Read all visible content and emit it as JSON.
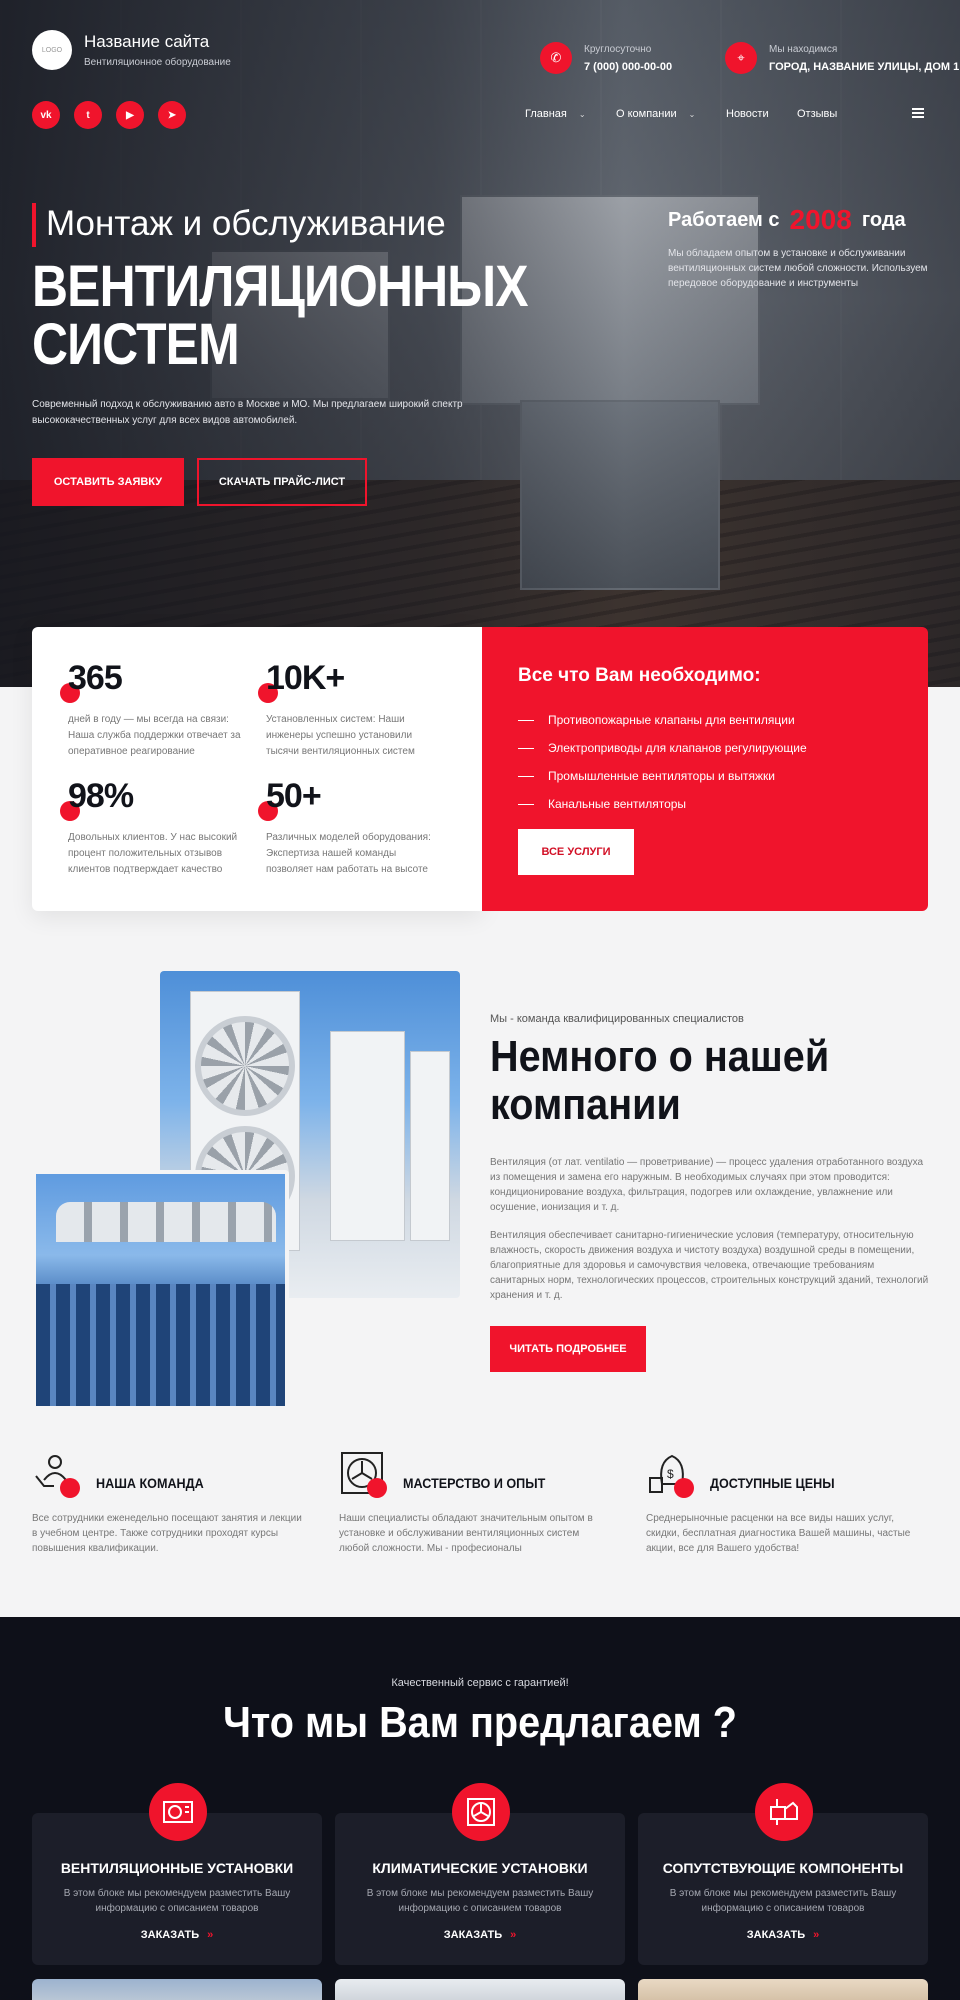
{
  "header": {
    "logo_text": "LOGO",
    "site_title": "Название сайта",
    "site_subtitle": "Вентиляционное оборудование",
    "contacts": [
      {
        "icon": "phone-icon",
        "label": "Круглосуточно",
        "value": "7 (000) 000-00-00"
      },
      {
        "icon": "location-icon",
        "label": "Мы находимся",
        "value": "ГОРОД, НАЗВАНИЕ УЛИЦЫ, ДОМ 1"
      }
    ],
    "social": [
      {
        "icon": "vk-icon",
        "glyph": "vk"
      },
      {
        "icon": "twitter-icon",
        "glyph": "t"
      },
      {
        "icon": "youtube-icon",
        "glyph": "▶"
      },
      {
        "icon": "telegram-icon",
        "glyph": "➤"
      }
    ],
    "nav": [
      {
        "label": "Главная",
        "has_dropdown": true
      },
      {
        "label": "О компании",
        "has_dropdown": true
      },
      {
        "label": "Новости",
        "has_dropdown": false
      },
      {
        "label": "Отзывы",
        "has_dropdown": false
      }
    ]
  },
  "hero": {
    "title_small": "Монтаж и обслуживание",
    "title_big_1": "ВЕНТИЛЯЦИОННЫХ",
    "title_big_2": "СИСТЕМ",
    "description": "Современный подход к обслуживанию авто в Москве и МО. Мы предлагаем широкий спектр высококачественных услуг для всех видов автомобилей.",
    "btn_primary": "ОСТАВИТЬ ЗАЯВКУ",
    "btn_secondary": "СКАЧАТЬ ПРАЙС-ЛИСТ",
    "work_prefix": "Работаем с",
    "work_year": "2008",
    "work_suffix": "года",
    "work_desc": "Мы обладаем опытом в установке и обслуживании вентиляционных систем любой сложности. Используем передовое оборудование и инструменты"
  },
  "stats": [
    {
      "value": "365",
      "text": "дней в году — мы всегда на связи: Наша служба поддержки отвечает за оперативное реагирование"
    },
    {
      "value": "10K+",
      "text": "Установленных систем: Наши инженеры успешно установили тысячи вентиляционных систем"
    },
    {
      "value": "98%",
      "text": "Довольных клиентов. У нас высокий процент положительных отзывов клиентов подтверждает качество"
    },
    {
      "value": "50+",
      "text": "Различных моделей оборудования: Экспертиза нашей команды позволяет нам работать на высоте"
    }
  ],
  "needs": {
    "title": "Все что Вам необходимо:",
    "items": [
      "Противопожарные клапаны для вентиляции",
      "Электроприводы для клапанов регулирующие",
      "Промышленные вентиляторы и вытяжки",
      "Канальные вентиляторы"
    ],
    "button": "ВСЕ УСЛУГИ"
  },
  "about": {
    "pretitle": "Мы - команда квалифицированных специалистов",
    "title": "Немного о нашей компании",
    "paragraph_1": "Вентиляция (от лат. ventilatio — проветривание) — процесс удаления отработанного воздуха из помещения и замена его наружным. В необходимых случаях при этом проводится: кондиционирование воздуха, фильтрация, подогрев или охлаждение, увлажнение или осушение, ионизация и т. д.",
    "paragraph_2": "Вентиляция обеспечивает санитарно-гигиенические условия (температуру, относительную влажность, скорость движения воздуха и чистоту воздуха) воздушной среды в помещении, благоприятные для здоровья и самочувствия человека, отвечающие требованиям санитарных норм, технологических процессов, строительных конструкций зданий, технологий хранения и т. д.",
    "button": "ЧИТАТЬ ПОДРОБНЕЕ"
  },
  "features": [
    {
      "icon": "team-icon",
      "title": "НАША КОМАНДА",
      "text": "Все сотрудники еженедельно посещают занятия и лекции в учебном центре. Также сотрудники проходят курсы повышения квалификации."
    },
    {
      "icon": "fan-icon",
      "title": "МАСТЕРСТВО И ОПЫТ",
      "text": "Наши специалисты обладают значительным опытом в установке и обслуживании вентиляционных систем любой сложности. Мы - професионалы"
    },
    {
      "icon": "money-icon",
      "title": "ДОСТУПНЫЕ ЦЕНЫ",
      "text": "Среднерыночные расценки на все виды наших услуг, скидки, бесплатная диагностика Вашей машины, частые акции, все для Вашего удобства!"
    }
  ],
  "offers": {
    "pretitle": "Качественный сервис с гарантией!",
    "title": "Что мы Вам предлагаем ?",
    "cards": [
      {
        "icon": "ac-unit-icon",
        "title": "ВЕНТИЛЯЦИОННЫЕ УСТАНОВКИ",
        "text": "В этом блоке мы рекомендуем разместить Вашу информацию с описанием товаров",
        "order": "ЗАКАЗАТЬ"
      },
      {
        "icon": "fan-unit-icon",
        "title": "КЛИМАТИЧЕСКИЕ УСТАНОВКИ",
        "text": "В этом блоке мы рекомендуем разместить Вашу информацию с описанием товаров",
        "order": "ЗАКАЗАТЬ"
      },
      {
        "icon": "components-icon",
        "title": "СОПУТСТВУЮЩИЕ КОМПОНЕНТЫ",
        "text": "В этом блоке мы рекомендуем разместить Вашу информацию с описанием товаров",
        "order": "ЗАКАЗАТЬ"
      }
    ]
  },
  "colors": {
    "accent": "#f0142c",
    "dark": "#0e1019",
    "card": "#1c1e29"
  }
}
